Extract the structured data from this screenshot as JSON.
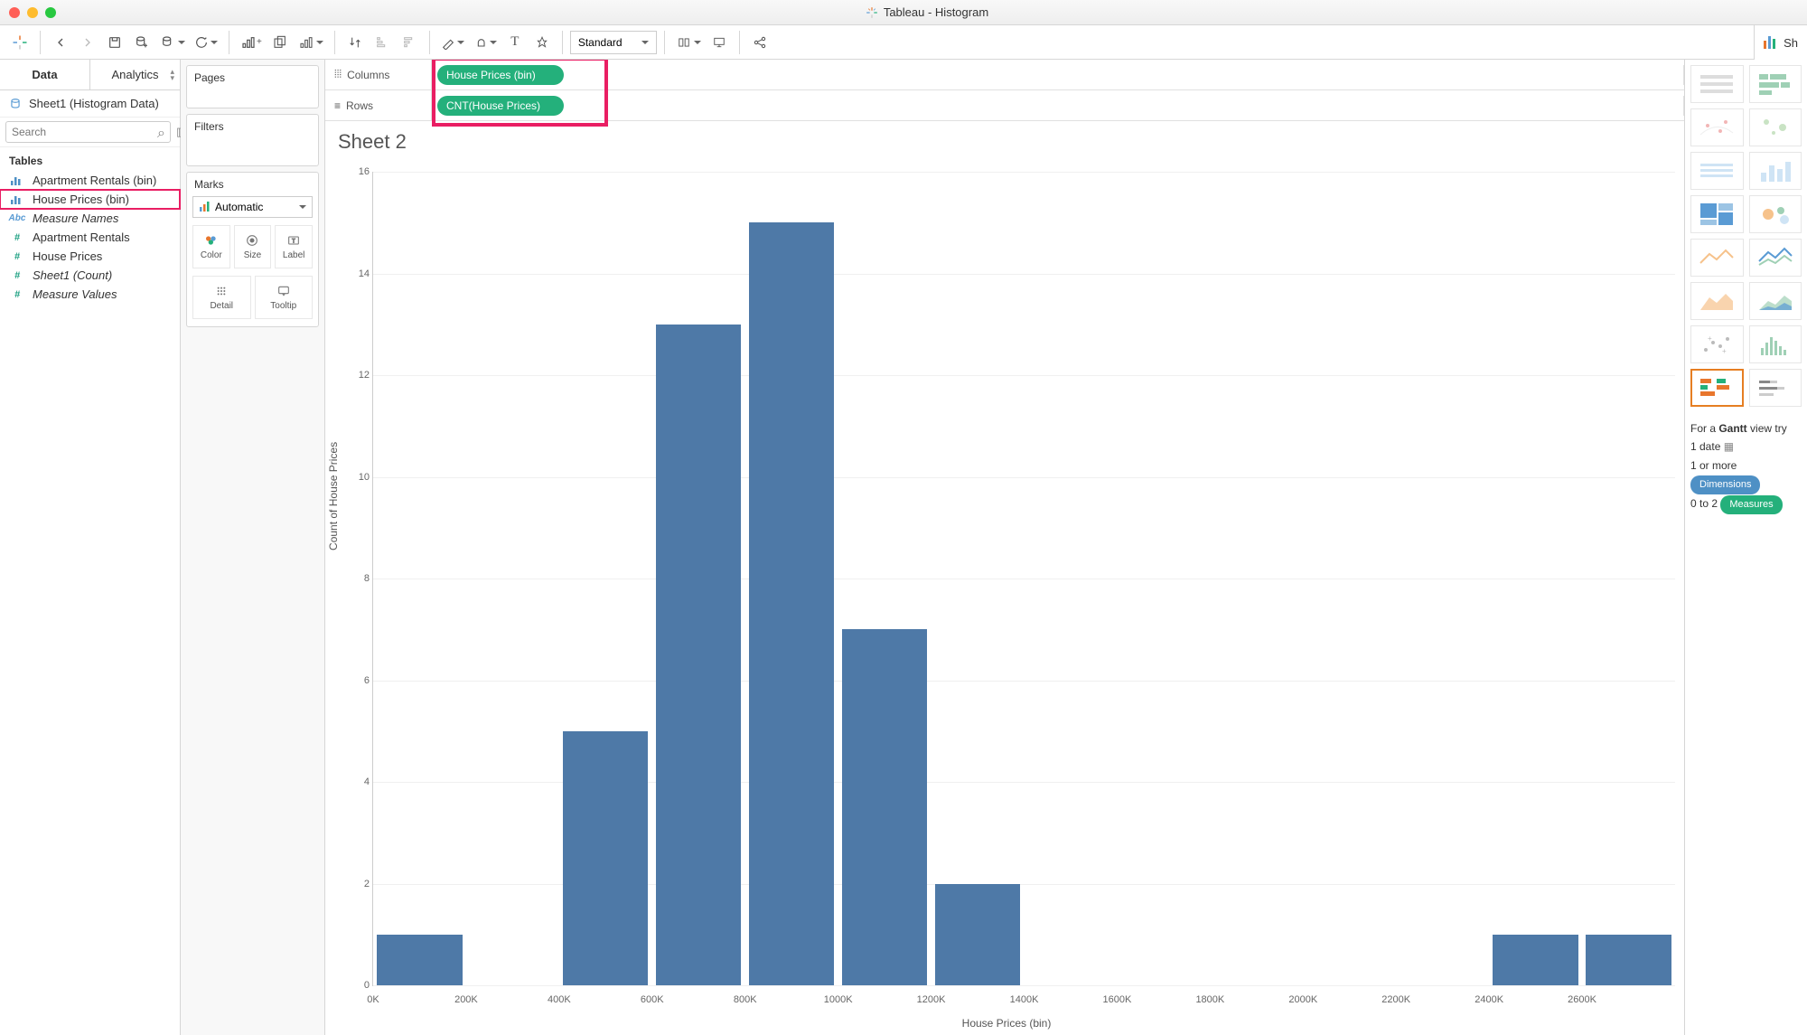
{
  "window": {
    "title": "Tableau - Histogram"
  },
  "toolbar": {
    "fit_label": "Standard",
    "showme_label": "Sh"
  },
  "left": {
    "tabs": {
      "data": "Data",
      "analytics": "Analytics"
    },
    "datasource": "Sheet1 (Histogram Data)",
    "search_placeholder": "Search",
    "section": "Tables",
    "fields": [
      {
        "icon": "bin-dim",
        "label": "Apartment Rentals (bin)",
        "italic": false,
        "hl": false
      },
      {
        "icon": "bin-dim",
        "label": "House Prices (bin)",
        "italic": false,
        "hl": true
      },
      {
        "icon": "abc",
        "label": "Measure Names",
        "italic": true,
        "hl": false
      },
      {
        "icon": "hash",
        "label": "Apartment Rentals",
        "italic": false,
        "hl": false
      },
      {
        "icon": "hash",
        "label": "House Prices",
        "italic": false,
        "hl": false
      },
      {
        "icon": "hash",
        "label": "Sheet1 (Count)",
        "italic": true,
        "hl": false
      },
      {
        "icon": "hash",
        "label": "Measure Values",
        "italic": true,
        "hl": false
      }
    ]
  },
  "cards": {
    "pages": "Pages",
    "filters": "Filters",
    "marks": "Marks",
    "mark_type": "Automatic",
    "btns": {
      "color": "Color",
      "size": "Size",
      "label": "Label",
      "detail": "Detail",
      "tooltip": "Tooltip"
    }
  },
  "shelves": {
    "columns_label": "Columns",
    "rows_label": "Rows",
    "col_pill": "House Prices (bin)",
    "row_pill": "CNT(House Prices)"
  },
  "sheet": {
    "title": "Sheet 2"
  },
  "chart_data": {
    "type": "bar",
    "title": "",
    "xlabel": "House Prices (bin)",
    "ylabel": "Count of House Prices",
    "ylim": [
      0,
      16
    ],
    "yticks": [
      0,
      2,
      4,
      6,
      8,
      10,
      12,
      14,
      16
    ],
    "xticks": [
      "0K",
      "200K",
      "400K",
      "600K",
      "800K",
      "1000K",
      "1200K",
      "1400K",
      "1600K",
      "1800K",
      "2000K",
      "2200K",
      "2400K",
      "2600K"
    ],
    "categories": [
      "0K",
      "200K",
      "400K",
      "600K",
      "800K",
      "1000K",
      "1200K",
      "1400K",
      "1600K",
      "1800K",
      "2000K",
      "2200K",
      "2400K",
      "2600K"
    ],
    "values": [
      1,
      0,
      5,
      13,
      15,
      7,
      2,
      0,
      0,
      0,
      0,
      0,
      1,
      1
    ],
    "bin_step_label": "200K"
  },
  "showme": {
    "hint_lead": "For a ",
    "hint_bold": "Gantt",
    "hint_tail": " view try",
    "line1a": "1 date ",
    "line2a": "1 or more ",
    "line2_pill": "Dimensions",
    "line3a": "0 to 2 ",
    "line3_pill": "Measures"
  }
}
